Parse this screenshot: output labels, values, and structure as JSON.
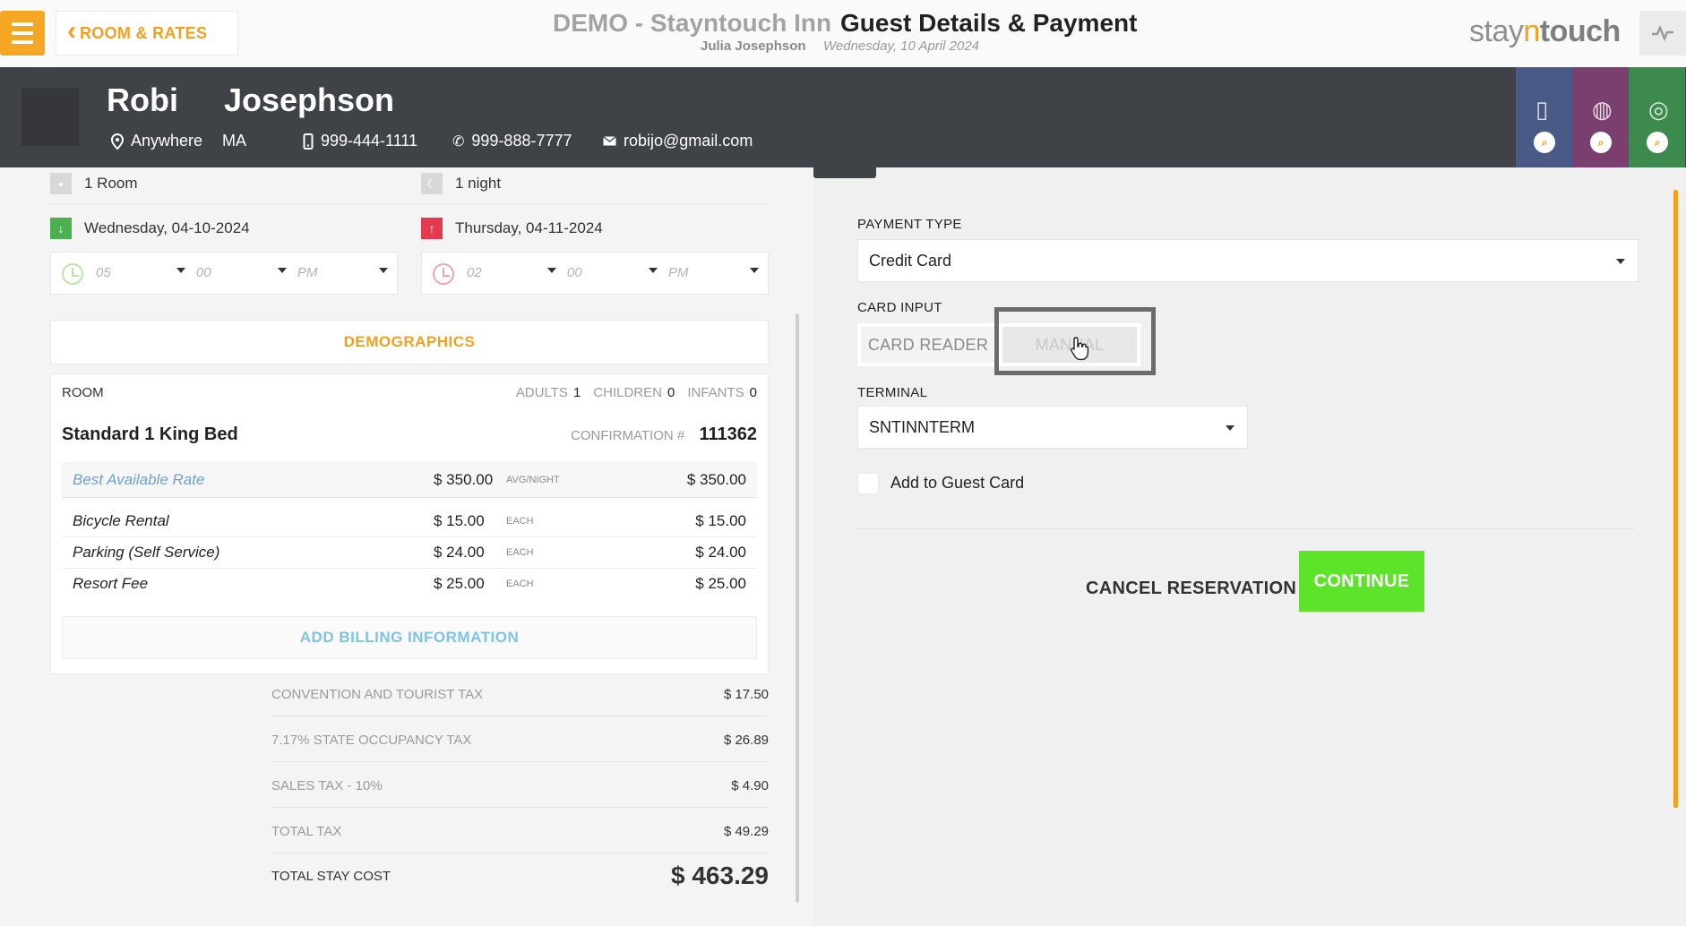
{
  "topbar": {
    "back_label": "ROOM & RATES",
    "hotel_name": "DEMO - Stayntouch Inn",
    "page_title": "Guest Details & Payment",
    "user_name": "Julia Josephson",
    "business_date": "Wednesday, 10 April 2024",
    "logo": {
      "pre": "stay",
      "n": "n",
      "post": "touch"
    }
  },
  "guest": {
    "first_name": "Robi",
    "last_name": "Josephson",
    "city": "Anywhere",
    "state": "MA",
    "mobile": "999-444-1111",
    "phone": "999-888-7777",
    "email": "robijo@gmail.com",
    "side_tab_colors": [
      "#4a5a86",
      "#7a3f6e",
      "#3d8a4f"
    ]
  },
  "stay": {
    "rooms": "1 Room",
    "nights": "1 night",
    "arrival_date": "Wednesday, 04-10-2024",
    "departure_date": "Thursday, 04-11-2024",
    "arrival_time": {
      "hour": "05",
      "min": "00",
      "ampm": "PM"
    },
    "departure_time": {
      "hour": "02",
      "min": "00",
      "ampm": "PM"
    }
  },
  "demographics_label": "DEMOGRAPHICS",
  "room": {
    "label": "ROOM",
    "adults_label": "ADULTS",
    "adults": "1",
    "children_label": "CHILDREN",
    "children": "0",
    "infants_label": "INFANTS",
    "infants": "0",
    "room_type": "Standard 1 King Bed",
    "confirmation_label": "CONFIRMATION #",
    "confirmation_no": "111362",
    "rate": {
      "name": "Best Available Rate",
      "amount": "$ 350.00",
      "unit": "AVG/NIGHT",
      "total": "$ 350.00"
    },
    "addons": [
      {
        "name": "Bicycle Rental",
        "amount": "$ 15.00",
        "unit": "EACH",
        "total": "$ 15.00"
      },
      {
        "name": "Parking (Self Service)",
        "amount": "$ 24.00",
        "unit": "EACH",
        "total": "$ 24.00"
      },
      {
        "name": "Resort Fee",
        "amount": "$ 25.00",
        "unit": "EACH",
        "total": "$ 25.00"
      }
    ],
    "add_billing_label": "ADD BILLING INFORMATION"
  },
  "taxes": [
    {
      "label": "CONVENTION AND TOURIST TAX",
      "value": "$ 17.50"
    },
    {
      "label": "7.17% STATE OCCUPANCY TAX",
      "value": "$ 26.89"
    },
    {
      "label": "SALES TAX - 10%",
      "value": "$ 4.90"
    },
    {
      "label": "TOTAL TAX",
      "value": "$ 49.29"
    }
  ],
  "total": {
    "label": "TOTAL STAY COST",
    "value": "$ 463.29"
  },
  "payment": {
    "type_label": "PAYMENT TYPE",
    "type_value": "Credit Card",
    "card_input_label": "CARD INPUT",
    "card_reader_label": "CARD READER",
    "manual_label": "MANUAL",
    "terminal_label": "TERMINAL",
    "terminal_value": "SNTINNTERM",
    "add_to_guest_card_label": "Add to Guest Card",
    "cancel_label": "CANCEL RESERVATION",
    "continue_label": "CONTINUE"
  },
  "colors": {
    "accent": "#f2a01f",
    "continue": "#5ce32a",
    "arrival": "#4caf50",
    "departure": "#e53950"
  }
}
